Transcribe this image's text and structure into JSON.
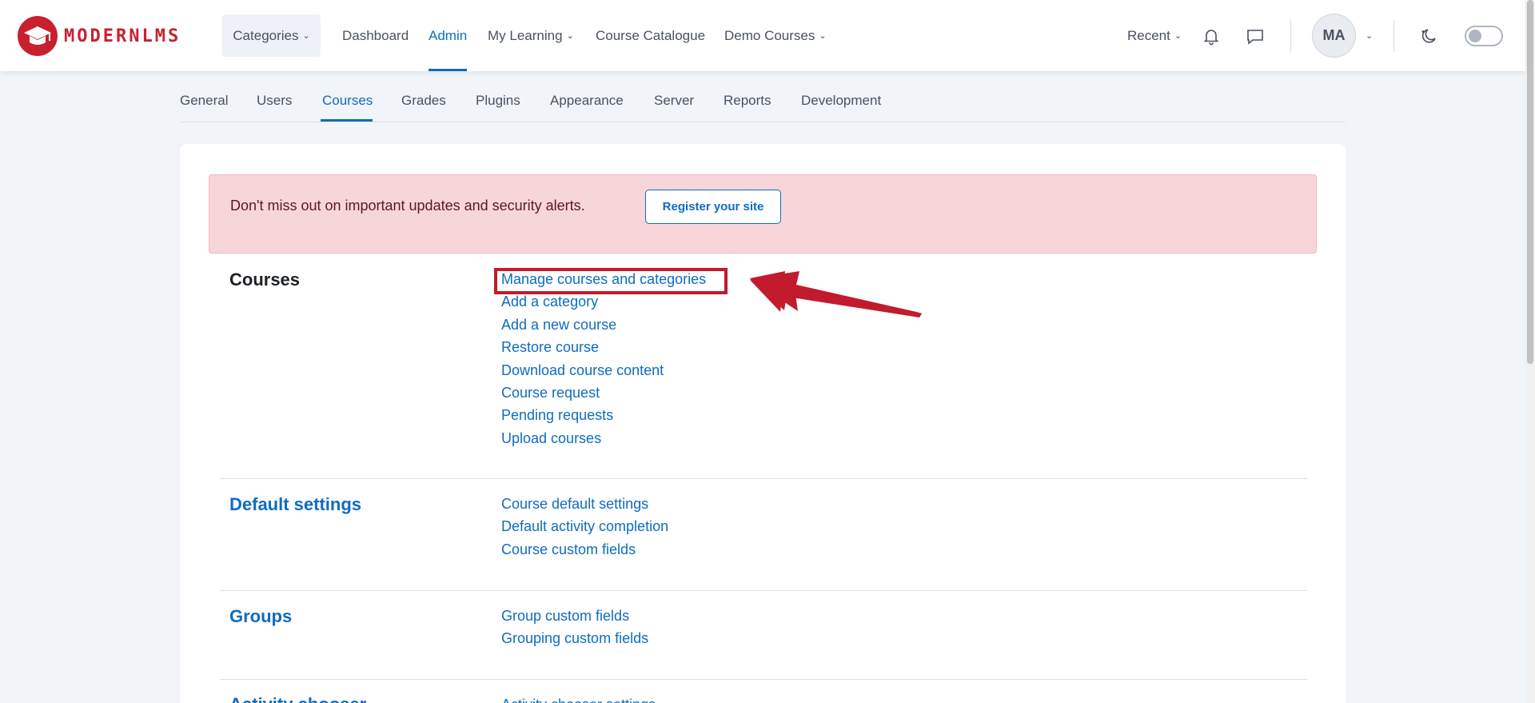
{
  "brand": {
    "name": "MODERNLMS",
    "color": "#c8202f"
  },
  "navbar": {
    "categories": "Categories",
    "dashboard": "Dashboard",
    "admin": "Admin",
    "my_learning": "My Learning",
    "course_catalogue": "Course Catalogue",
    "demo_courses": "Demo Courses",
    "recent": "Recent",
    "avatar_initials": "MA",
    "icons": [
      "bell-icon",
      "chat-icon",
      "moon-icon"
    ]
  },
  "admin_tabs": [
    "General",
    "Users",
    "Courses",
    "Grades",
    "Plugins",
    "Appearance",
    "Server",
    "Reports",
    "Development"
  ],
  "active_tab": "Courses",
  "alert": {
    "message": "Don't miss out on important updates and security alerts.",
    "button": "Register your site"
  },
  "sections": [
    {
      "title": "Courses",
      "links": [
        "Manage courses and categories",
        "Add a category",
        "Add a new course",
        "Restore course",
        "Download course content",
        "Course request",
        "Pending requests",
        "Upload courses"
      ]
    },
    {
      "title": "Default settings",
      "links": [
        "Course default settings",
        "Default activity completion",
        "Course custom fields"
      ]
    },
    {
      "title": "Groups",
      "links": [
        "Group custom fields",
        "Grouping custom fields"
      ]
    },
    {
      "title": "Activity chooser",
      "links": [
        "Activity chooser settings"
      ]
    }
  ],
  "colors": {
    "accent": "#0f6cbf",
    "annotation": "#c21b2e",
    "alert_bg": "#f7d6da"
  }
}
